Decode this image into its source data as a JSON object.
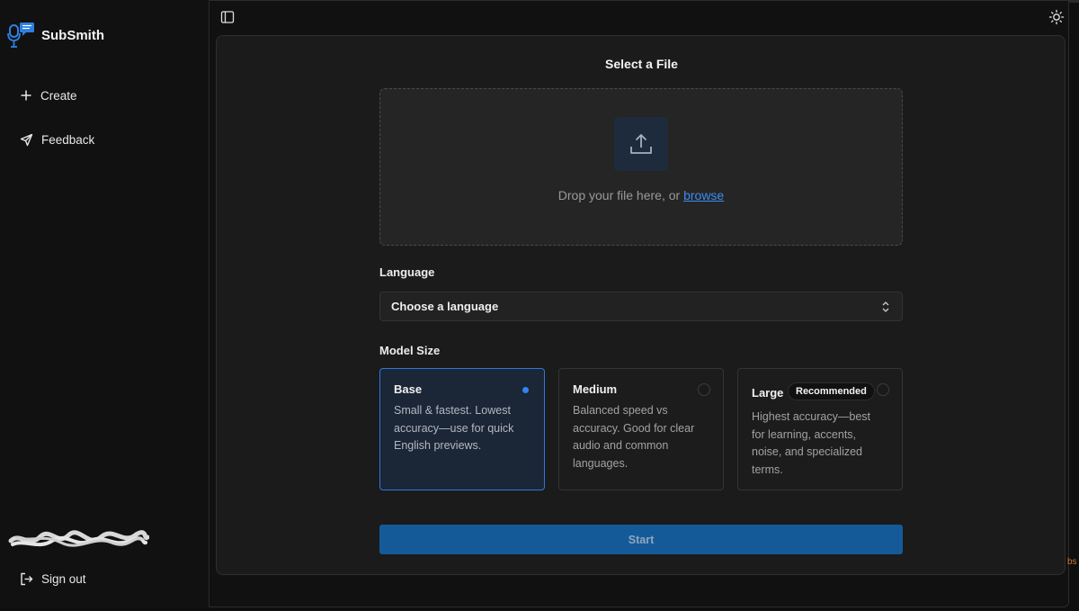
{
  "app": {
    "name": "SubSmith"
  },
  "sidebar": {
    "items": [
      {
        "label": "Create",
        "icon": "plus-icon"
      },
      {
        "label": "Feedback",
        "icon": "send-icon"
      }
    ],
    "signout_label": "Sign out"
  },
  "main": {
    "title": "Select a File",
    "dropzone": {
      "text": "Drop your file here, or",
      "link": "browse"
    },
    "language": {
      "label": "Language",
      "value": "Choose a language"
    },
    "model_size": {
      "label": "Model Size",
      "options": [
        {
          "name": "Base",
          "description": "Small & fastest. Lowest accuracy—use for quick English previews.",
          "selected": true
        },
        {
          "name": "Medium",
          "description": "Balanced speed vs accuracy. Good for clear audio and common languages.",
          "selected": false
        },
        {
          "name": "Large",
          "badge": "Recommended",
          "description": "Highest accuracy—best for learning, accents, noise, and specialized terms.",
          "selected": false
        }
      ]
    },
    "start_label": "Start"
  },
  "colors": {
    "accent": "#2f86f0",
    "start_button": "#155a98",
    "selected_card_bg": "#1b2636"
  },
  "edge_hint": "bs"
}
